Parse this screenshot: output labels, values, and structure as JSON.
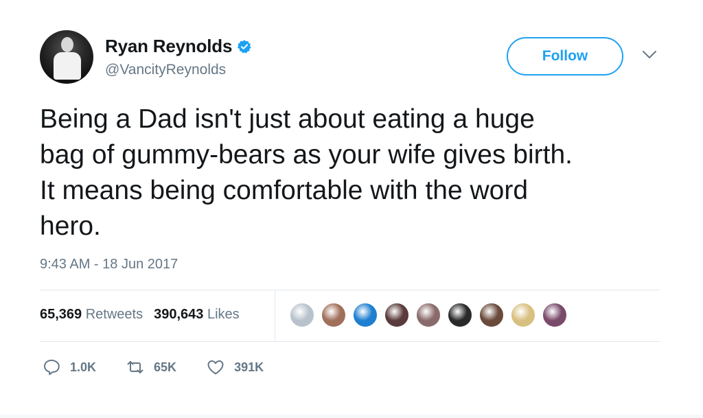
{
  "user": {
    "name": "Ryan Reynolds",
    "handle": "@VancityReynolds",
    "verified": true
  },
  "follow_button": {
    "label": "Follow"
  },
  "tweet": {
    "lines": [
      "Being a Dad isn't just about eating a huge",
      "bag of gummy-bears as your wife gives birth.",
      "It means being comfortable with the word",
      "hero."
    ],
    "timestamp": "9:43 AM - 18 Jun 2017"
  },
  "stats": {
    "retweets_count": "65,369",
    "retweets_label": "Retweets",
    "likes_count": "390,643",
    "likes_label": "Likes"
  },
  "likers": [
    {
      "name": "liker-1",
      "color": "#b8c2cc"
    },
    {
      "name": "liker-2",
      "color": "#a0705a"
    },
    {
      "name": "liker-3",
      "color": "#1e7fd0"
    },
    {
      "name": "liker-4",
      "color": "#5a3a3a"
    },
    {
      "name": "liker-5",
      "color": "#8a6a6a"
    },
    {
      "name": "liker-6",
      "color": "#2a2a2a"
    },
    {
      "name": "liker-7",
      "color": "#6a4a3a"
    },
    {
      "name": "liker-8",
      "color": "#d8c080"
    },
    {
      "name": "liker-9",
      "color": "#7a4a6a"
    }
  ],
  "actions": {
    "reply_count": "1.0K",
    "retweet_count": "65K",
    "like_count": "391K"
  },
  "colors": {
    "accent": "#1da1f2",
    "text": "#14171a",
    "secondary": "#657786",
    "divider": "#e1e8ed"
  }
}
